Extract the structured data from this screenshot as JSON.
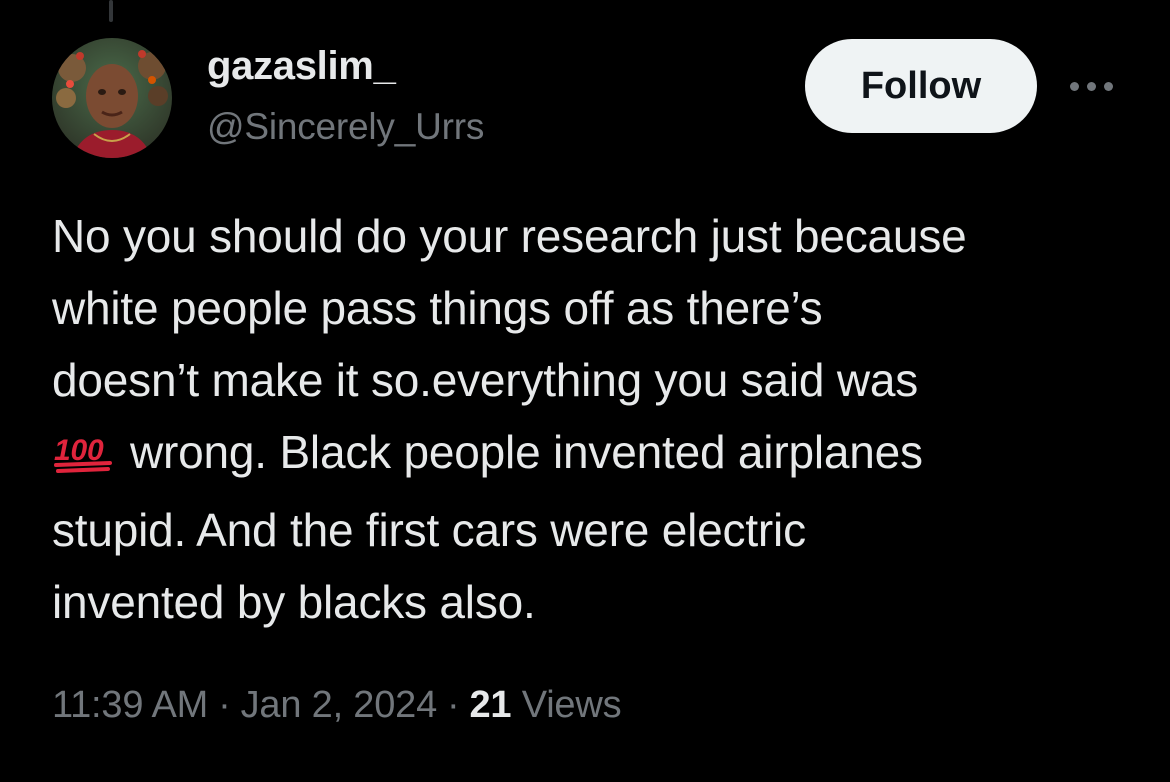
{
  "author": {
    "display_name": "gazaslim_",
    "handle": "@Sincerely_Urrs"
  },
  "actions": {
    "follow_label": "Follow",
    "more_icon": "more-horizontal-icon"
  },
  "tweet": {
    "lines": [
      "No you should do your research just because",
      "white people pass things off as there’s",
      "doesn’t make it so.everything you said was",
      "wrong. Black people invented airplanes",
      "stupid. And the first cars were electric",
      "invented by blacks also."
    ],
    "emoji": "hundred-points-icon",
    "time": "11:39 AM",
    "date": "Jan 2, 2024",
    "separator": "·",
    "views_count": "21",
    "views_label": "Views"
  },
  "colors": {
    "background": "#000000",
    "primary_text": "#e7e9ea",
    "secondary_text": "#71767b",
    "follow_button_bg": "#eff3f4",
    "emoji_red": "#e0243c"
  }
}
